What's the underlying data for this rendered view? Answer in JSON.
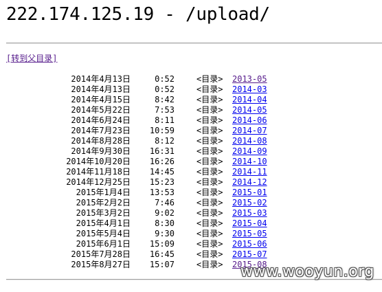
{
  "header": {
    "title": "222.174.125.19 - /upload/"
  },
  "nav": {
    "parent_link": "[转到父目录]"
  },
  "listing": {
    "entries": [
      {
        "date": "2014年4月13日",
        "time": "0:52",
        "type": "<目录>",
        "name": "2013-05",
        "visited": true
      },
      {
        "date": "2014年4月13日",
        "time": "0:52",
        "type": "<目录>",
        "name": "2014-03",
        "visited": false
      },
      {
        "date": "2014年4月15日",
        "time": "8:42",
        "type": "<目录>",
        "name": "2014-04",
        "visited": false
      },
      {
        "date": "2014年5月22日",
        "time": "7:53",
        "type": "<目录>",
        "name": "2014-05",
        "visited": false
      },
      {
        "date": "2014年6月24日",
        "time": "8:11",
        "type": "<目录>",
        "name": "2014-06",
        "visited": false
      },
      {
        "date": "2014年7月23日",
        "time": "10:59",
        "type": "<目录>",
        "name": "2014-07",
        "visited": false
      },
      {
        "date": "2014年8月28日",
        "time": "8:12",
        "type": "<目录>",
        "name": "2014-08",
        "visited": false
      },
      {
        "date": "2014年9月30日",
        "time": "16:31",
        "type": "<目录>",
        "name": "2014-09",
        "visited": false
      },
      {
        "date": "2014年10月20日",
        "time": "16:26",
        "type": "<目录>",
        "name": "2014-10",
        "visited": false
      },
      {
        "date": "2014年11月18日",
        "time": "14:45",
        "type": "<目录>",
        "name": "2014-11",
        "visited": false
      },
      {
        "date": "2014年12月25日",
        "time": "15:23",
        "type": "<目录>",
        "name": "2014-12",
        "visited": false
      },
      {
        "date": "2015年1月4日",
        "time": "13:53",
        "type": "<目录>",
        "name": "2015-01",
        "visited": false
      },
      {
        "date": "2015年2月2日",
        "time": "7:46",
        "type": "<目录>",
        "name": "2015-02",
        "visited": false
      },
      {
        "date": "2015年3月2日",
        "time": "9:02",
        "type": "<目录>",
        "name": "2015-03",
        "visited": false
      },
      {
        "date": "2015年4月1日",
        "time": "8:30",
        "type": "<目录>",
        "name": "2015-04",
        "visited": false
      },
      {
        "date": "2015年5月4日",
        "time": "9:30",
        "type": "<目录>",
        "name": "2015-05",
        "visited": false
      },
      {
        "date": "2015年6月1日",
        "time": "15:09",
        "type": "<目录>",
        "name": "2015-06",
        "visited": false
      },
      {
        "date": "2015年7月28日",
        "time": "16:45",
        "type": "<目录>",
        "name": "2015-07",
        "visited": false
      },
      {
        "date": "2015年8月27日",
        "time": "15:07",
        "type": "<目录>",
        "name": "2015-08",
        "visited": true
      }
    ]
  },
  "watermark": {
    "text": "www.wooyun.org"
  },
  "colors": {
    "link": "#0000ee",
    "visited_link": "#551a8b"
  }
}
